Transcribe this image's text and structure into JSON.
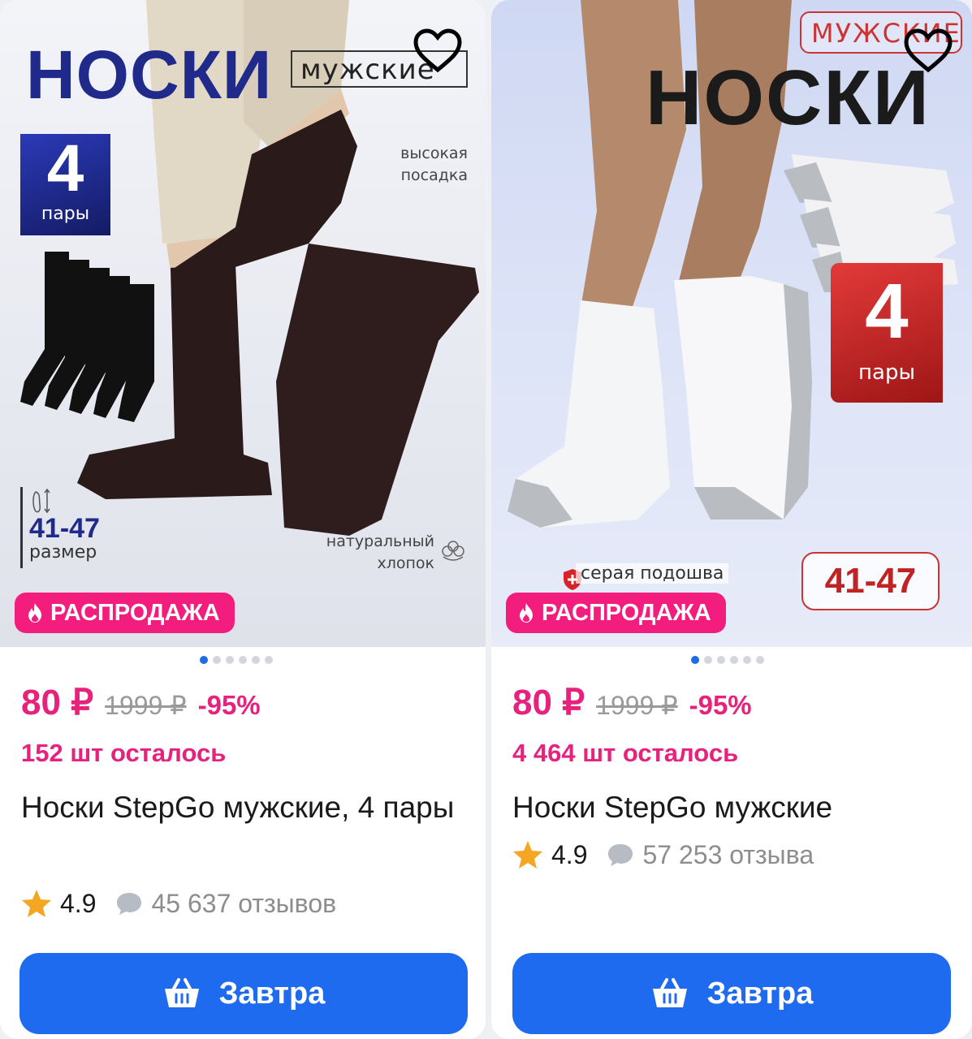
{
  "products": [
    {
      "photo": {
        "title": "НОСКИ",
        "subtitle": "мужские",
        "pack_count": "4",
        "pack_unit": "пары",
        "feature_top": [
          "высокая",
          "посадка"
        ],
        "feature_bottom": [
          "натуральный",
          "хлопок"
        ],
        "size_range": "41-47",
        "size_label": "размер"
      },
      "sale_label": "РАСПРОДАЖА",
      "gallery": {
        "count": 6,
        "active_index": 0
      },
      "price": "80 ₽",
      "old_price": "1999 ₽",
      "discount": "-95%",
      "stock": "152 шт осталось",
      "name": "Носки StepGo мужские, 4 пары",
      "rating": "4.9",
      "reviews": "45 637 отзывов",
      "buy_label": "Завтра",
      "favorite": false
    },
    {
      "photo": {
        "title": "НОСКИ",
        "subtitle": "МУЖСКИЕ",
        "pack_count": "4",
        "pack_unit": "пары",
        "note": "серая подошва",
        "size_range": "41-47"
      },
      "sale_label": "РАСПРОДАЖА",
      "gallery": {
        "count": 6,
        "active_index": 0
      },
      "price": "80 ₽",
      "old_price": "1999 ₽",
      "discount": "-95%",
      "stock": "4 464 шт осталось",
      "name": "Носки StepGo мужские",
      "rating": "4.9",
      "reviews": "57 253 отзыва",
      "buy_label": "Завтра",
      "favorite": false
    }
  ],
  "colors": {
    "accent_pink": "#e6227c",
    "sale_badge": "#f21d7c",
    "buy_button": "#1f6bf0",
    "active_dot": "#1e6be6",
    "star": "#f5a623"
  },
  "icons": [
    "heart-outline-icon",
    "flame-icon",
    "star-icon",
    "comment-bubble-icon",
    "basket-icon",
    "cotton-icon",
    "foot-size-icon",
    "shield-plus-icon"
  ]
}
